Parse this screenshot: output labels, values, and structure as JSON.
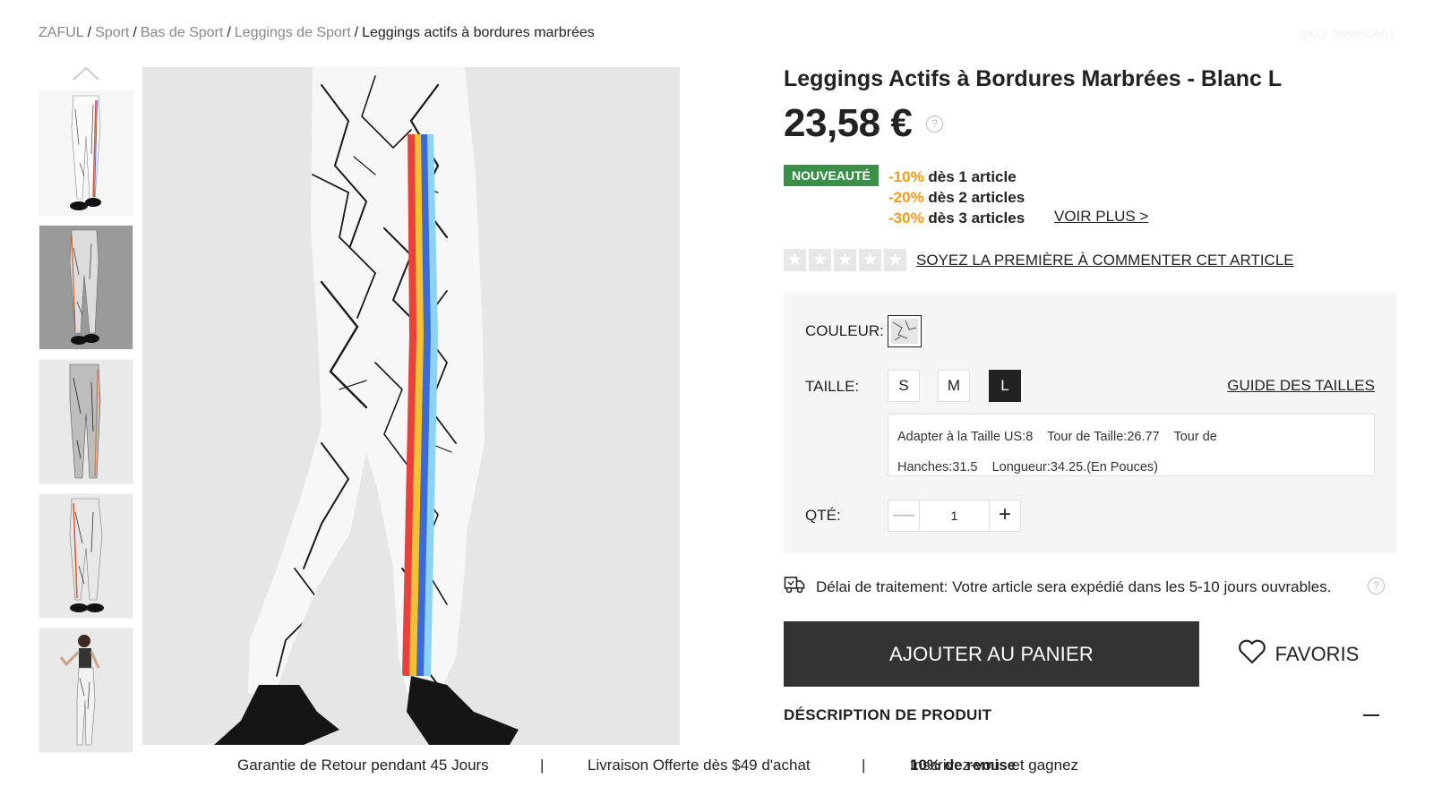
{
  "breadcrumb": {
    "items": [
      "ZAFUL",
      "Sport",
      "Bas de Sport",
      "Leggings de Sport"
    ],
    "current": "Leggings actifs à bordures marbrées",
    "separator": "/"
  },
  "sku": "SKU: 269950601",
  "product": {
    "title": "Leggings Actifs à Bordures Marbrées - Blanc L",
    "price": "23,58 €",
    "badge": "NOUVEAUTÉ",
    "discounts": [
      {
        "pct": "-10%",
        "text": " dès 1 article"
      },
      {
        "pct": "-20%",
        "text": " dès 2 articles"
      },
      {
        "pct": "-30%",
        "text": " dès 3 articles"
      }
    ],
    "voir_plus": "VOIR PLUS >",
    "rating_stars": 0,
    "review_link": "SOYEZ LA PREMIÈRE À COMMENTER CET ARTICLE"
  },
  "options": {
    "color_label": "COULEUR:",
    "size_label": "TAILLE:",
    "sizes": [
      "S",
      "M",
      "L"
    ],
    "selected_size": "L",
    "size_guide": "GUIDE DES TAILLES",
    "size_info_line1": "Adapter à la Taille US:8    Tour de Taille:26.77    Tour de",
    "size_info_line2": "Hanches:31.5    Longueur:34.25.(En Pouces)",
    "qty_label": "QTÉ:",
    "qty_value": "1",
    "minus": "—",
    "plus": "+"
  },
  "shipping": {
    "text": "Délai de traitement: Votre article sera expédié dans les 5-10 jours ouvrables."
  },
  "help_glyph": "?",
  "star_glyph": "★",
  "actions": {
    "add_to_cart": "AJOUTER AU PANIER",
    "favorites": "FAVORIS"
  },
  "description": {
    "heading": "DÉSCRIPTION DE PRODUIT"
  },
  "footer": {
    "item1": "Garantie de Retour pendant 45 Jours",
    "item2": "Livraison Offerte dès $49 d'achat",
    "item3_prefix": "Inscrivez-vous et gagnez ",
    "item3_bold": "10% de remise",
    "divider": "|"
  },
  "colors": {
    "accent_green": "#3a8f49",
    "discount_orange": "#f29b1d",
    "button_dark": "#333333"
  }
}
